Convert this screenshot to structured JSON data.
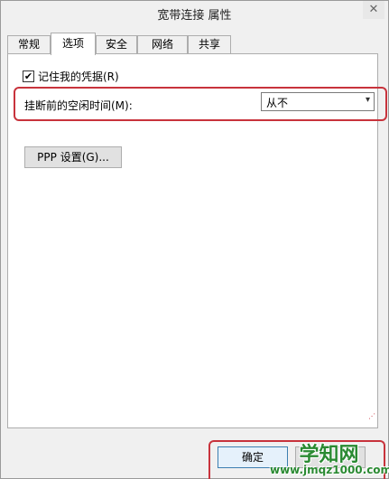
{
  "window": {
    "title": "宽带连接 属性",
    "close_glyph": "✕"
  },
  "tabs": [
    {
      "label": "常规",
      "active": false
    },
    {
      "label": "选项",
      "active": true
    },
    {
      "label": "安全",
      "active": false
    },
    {
      "label": "网络",
      "active": false
    },
    {
      "label": "共享",
      "active": false
    }
  ],
  "options": {
    "remember_credentials_label": "记住我的凭据(R)",
    "remember_credentials_checked": true,
    "checkmark_glyph": "✔",
    "idle_time_label": "挂断前的空闲时间(M):",
    "idle_time_value": "从不",
    "dropdown_arrow_glyph": "▾",
    "ppp_button_label": "PPP 设置(G)..."
  },
  "footer": {
    "ok_label": "确定",
    "cancel_label": ""
  },
  "watermark": {
    "title": "学知网",
    "url": "www.jmqz1000.com"
  },
  "colors": {
    "highlight": "#c8333c",
    "watermark_green": "#2a8a32"
  }
}
